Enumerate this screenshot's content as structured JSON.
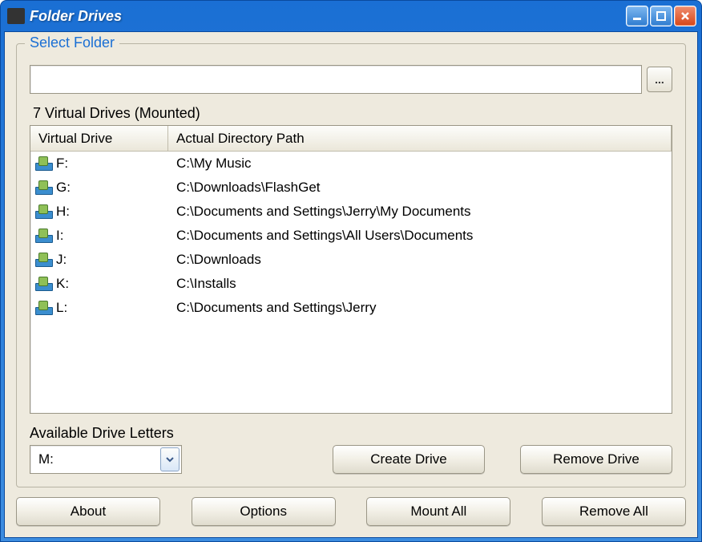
{
  "window": {
    "title": "Folder Drives"
  },
  "group": {
    "legend": "Select Folder",
    "folder_path": "",
    "browse_label": "...",
    "drives_caption": "7 Virtual Drives (Mounted)"
  },
  "columns": {
    "c0": "Virtual Drive",
    "c1": "Actual Directory Path"
  },
  "drives": [
    {
      "letter": "F:",
      "path": "C:\\My Music"
    },
    {
      "letter": "G:",
      "path": "C:\\Downloads\\FlashGet"
    },
    {
      "letter": "H:",
      "path": "C:\\Documents and Settings\\Jerry\\My Documents"
    },
    {
      "letter": "I:",
      "path": "C:\\Documents and Settings\\All Users\\Documents"
    },
    {
      "letter": "J:",
      "path": "C:\\Downloads"
    },
    {
      "letter": "K:",
      "path": "C:\\Installs"
    },
    {
      "letter": "L:",
      "path": "C:\\Documents and Settings\\Jerry"
    }
  ],
  "available": {
    "label": "Available Drive Letters",
    "selected": "M:"
  },
  "buttons": {
    "create": "Create Drive",
    "remove": "Remove Drive",
    "about": "About",
    "options": "Options",
    "mount_all": "Mount All",
    "remove_all": "Remove All"
  }
}
